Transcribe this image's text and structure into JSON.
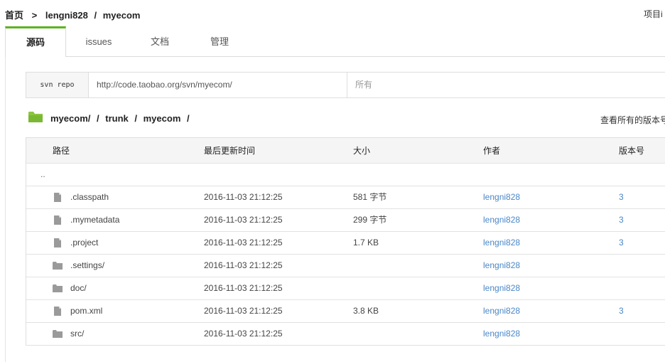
{
  "breadcrumb": {
    "home": "首页",
    "separator": ">",
    "owner": "lengni828",
    "slash": "/",
    "repo": "myecom"
  },
  "header_right_link": "项目i",
  "tabs": [
    {
      "label": "源码",
      "active": true
    },
    {
      "label": "issues",
      "active": false
    },
    {
      "label": "文档",
      "active": false
    },
    {
      "label": "管理",
      "active": false
    }
  ],
  "svn": {
    "label": "svn repo",
    "url": "http://code.taobao.org/svn/myecom/",
    "right_text": "所有"
  },
  "path": {
    "segments": [
      "myecom/",
      "trunk",
      "myecom"
    ],
    "separator": "/",
    "versions_link": "查看所有的版本号"
  },
  "table": {
    "headers": {
      "name": "路径",
      "time": "最后更新时间",
      "size": "大小",
      "author": "作者",
      "rev": "版本号"
    },
    "parent": "..",
    "rows": [
      {
        "type": "file",
        "name": ".classpath",
        "time": "2016-11-03 21:12:25",
        "size": "581 字节",
        "author": "lengni828",
        "rev": "3"
      },
      {
        "type": "file",
        "name": ".mymetadata",
        "time": "2016-11-03 21:12:25",
        "size": "299 字节",
        "author": "lengni828",
        "rev": "3"
      },
      {
        "type": "file",
        "name": ".project",
        "time": "2016-11-03 21:12:25",
        "size": "1.7 KB",
        "author": "lengni828",
        "rev": "3"
      },
      {
        "type": "folder",
        "name": ".settings/",
        "time": "2016-11-03 21:12:25",
        "size": "",
        "author": "lengni828",
        "rev": ""
      },
      {
        "type": "folder",
        "name": "doc/",
        "time": "2016-11-03 21:12:25",
        "size": "",
        "author": "lengni828",
        "rev": ""
      },
      {
        "type": "file",
        "name": "pom.xml",
        "time": "2016-11-03 21:12:25",
        "size": "3.8 KB",
        "author": "lengni828",
        "rev": "3"
      },
      {
        "type": "folder",
        "name": "src/",
        "time": "2016-11-03 21:12:25",
        "size": "",
        "author": "lengni828",
        "rev": ""
      }
    ]
  },
  "colors": {
    "accent": "#5fb21f",
    "link": "#4a87c8",
    "folder": "#8cc63f",
    "icon_gray": "#9a9a9a"
  },
  "icons": {
    "file": "file-icon",
    "folder": "folder-icon",
    "current_dir": "open-folder-icon"
  }
}
